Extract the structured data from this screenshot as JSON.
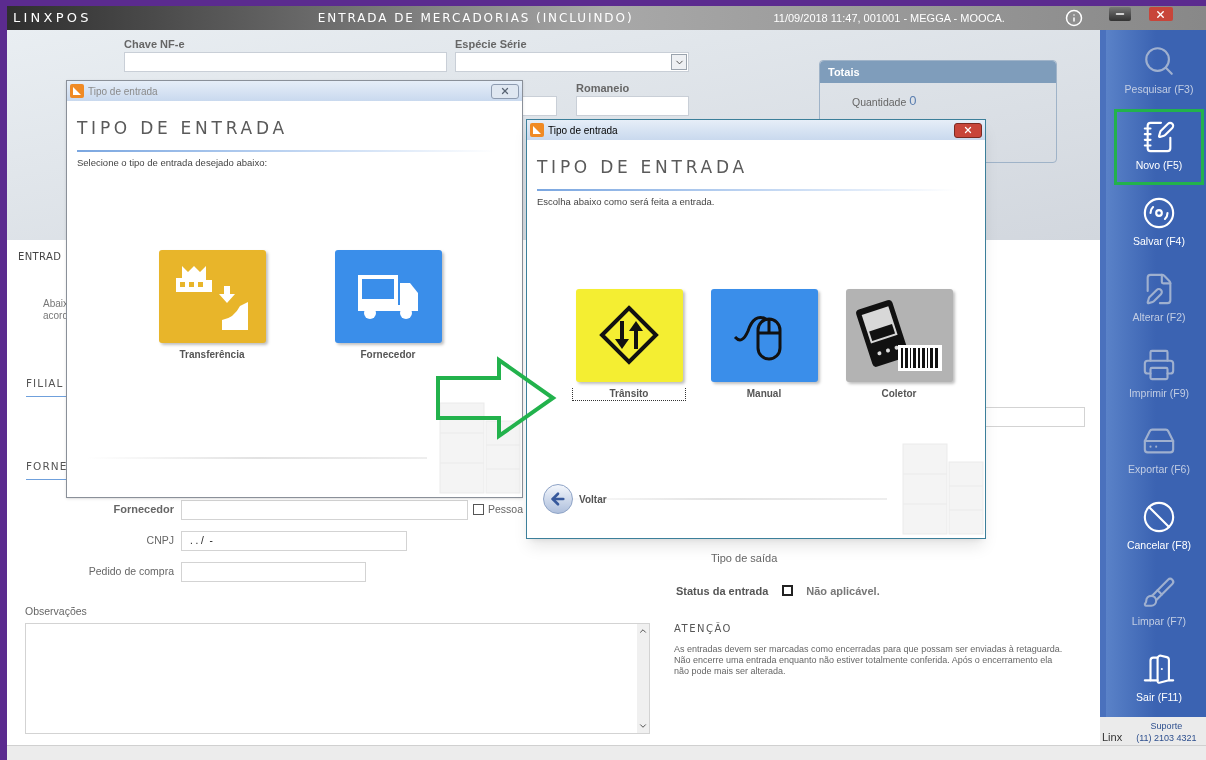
{
  "app": {
    "logo": "LINXPOS",
    "title": "ENTRADA DE MERCADORIAS (INCLUINDO)",
    "session": "11/09/2018 11:47, 001001 - MEGGA - MOOCA."
  },
  "header_fields": [
    {
      "label": "Chave NF-e",
      "kind": "text"
    },
    {
      "label": "Espécie Série",
      "kind": "select"
    }
  ],
  "header_fields_row2": [
    {
      "kind": "text"
    },
    {
      "label": "Romaneio",
      "kind": "text"
    }
  ],
  "totals": {
    "title": "Totais",
    "label": "Quantidade",
    "value": "0"
  },
  "form": {
    "section_title": "ENTRAD",
    "intro": [
      "Abaix",
      "acord"
    ],
    "filial_title": "FILIAL",
    "fornecedor_title": "FORNE",
    "fields": [
      {
        "label": "Fornecedor",
        "kind": "wide",
        "bold": true
      },
      {
        "label": "CNPJ",
        "kind": "medium",
        "bold": false,
        "value": ". . /  -"
      },
      {
        "label": "Pedido de compra",
        "kind": "short",
        "bold": false
      }
    ],
    "pessoa": {
      "label": "Pessoa",
      "checked": false
    },
    "observacoes": "Observações",
    "tipo_saida": "Tipo de saída",
    "status": {
      "label": "Status da entrada",
      "checked": false,
      "value": "Não aplicável."
    },
    "attention": {
      "title": "ATENÇÃO",
      "text": "As entradas devem ser marcadas como encerradas para que possam ser enviadas à retaguarda. Não encerre uma entrada enquanto não estiver totalmente conferida. Após o encerramento ela não pode mais ser alterada."
    }
  },
  "dialogs": [
    {
      "active": false,
      "title": "Tipo de entrada",
      "heading": "TIPO DE ENTRADA",
      "subtitle": "Selecione o tipo de entrada desejado abaixo:",
      "options": [
        {
          "label": "Transferência",
          "kind": "factory",
          "color": "#e8b52a",
          "focused": false
        },
        {
          "label": "Fornecedor",
          "kind": "truck",
          "color": "#3a8eea",
          "focused": false
        }
      ]
    },
    {
      "active": true,
      "title": "Tipo de entrada",
      "heading": "TIPO DE ENTRADA",
      "subtitle": "Escolha abaixo como será feita a entrada.",
      "back": "Voltar",
      "options": [
        {
          "label": "Trânsito",
          "kind": "sign",
          "color": "#f4ee32",
          "focused": true
        },
        {
          "label": "Manual",
          "kind": "mouse",
          "color": "#3a8eea",
          "focused": false
        },
        {
          "label": "Coletor",
          "kind": "pda",
          "color": "#b3b3b3",
          "focused": false
        }
      ]
    }
  ],
  "sidebar": {
    "buttons": [
      {
        "label": "Pesquisar (F3)",
        "kind": "search",
        "disabled": true,
        "highlighted": false
      },
      {
        "label": "Novo (F5)",
        "kind": "new",
        "disabled": false,
        "highlighted": true
      },
      {
        "label": "Salvar (F4)",
        "kind": "save",
        "disabled": false,
        "highlighted": false
      },
      {
        "label": "Alterar (F2)",
        "kind": "edit",
        "disabled": true,
        "highlighted": false
      },
      {
        "label": "Imprimir (F9)",
        "kind": "print",
        "disabled": true,
        "highlighted": false
      },
      {
        "label": "Exportar (F6)",
        "kind": "export",
        "disabled": true,
        "highlighted": false
      },
      {
        "label": "Cancelar (F8)",
        "kind": "cancel",
        "disabled": false,
        "highlighted": false
      },
      {
        "label": "Limpar (F7)",
        "kind": "clear",
        "disabled": true,
        "highlighted": false
      },
      {
        "label": "Sair (F11)",
        "kind": "exit",
        "disabled": false,
        "highlighted": false
      }
    ],
    "support": {
      "logo": "Linx",
      "label": "Suporte",
      "phone": "(11) 2103 4321"
    }
  }
}
